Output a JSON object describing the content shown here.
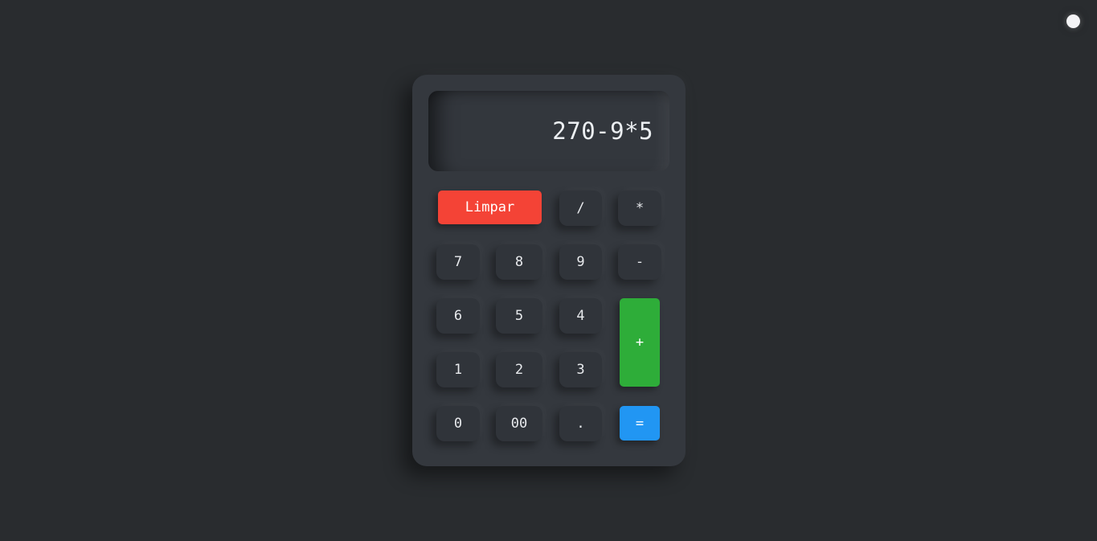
{
  "display": {
    "expression": "270-9*5"
  },
  "keys": {
    "clear": "Limpar",
    "divide": "/",
    "multiply": "*",
    "seven": "7",
    "eight": "8",
    "nine": "9",
    "minus": "-",
    "six": "6",
    "five": "5",
    "four": "4",
    "plus": "+",
    "one": "1",
    "two": "2",
    "three": "3",
    "zero": "0",
    "double_zero": "00",
    "decimal": ".",
    "equals": "="
  },
  "colors": {
    "background": "#292c2f",
    "calculator_body": "#34383e",
    "clear_button": "#f44336",
    "plus_button": "#2ead39",
    "equals_button": "#2196f3",
    "text": "#e8eaed"
  }
}
